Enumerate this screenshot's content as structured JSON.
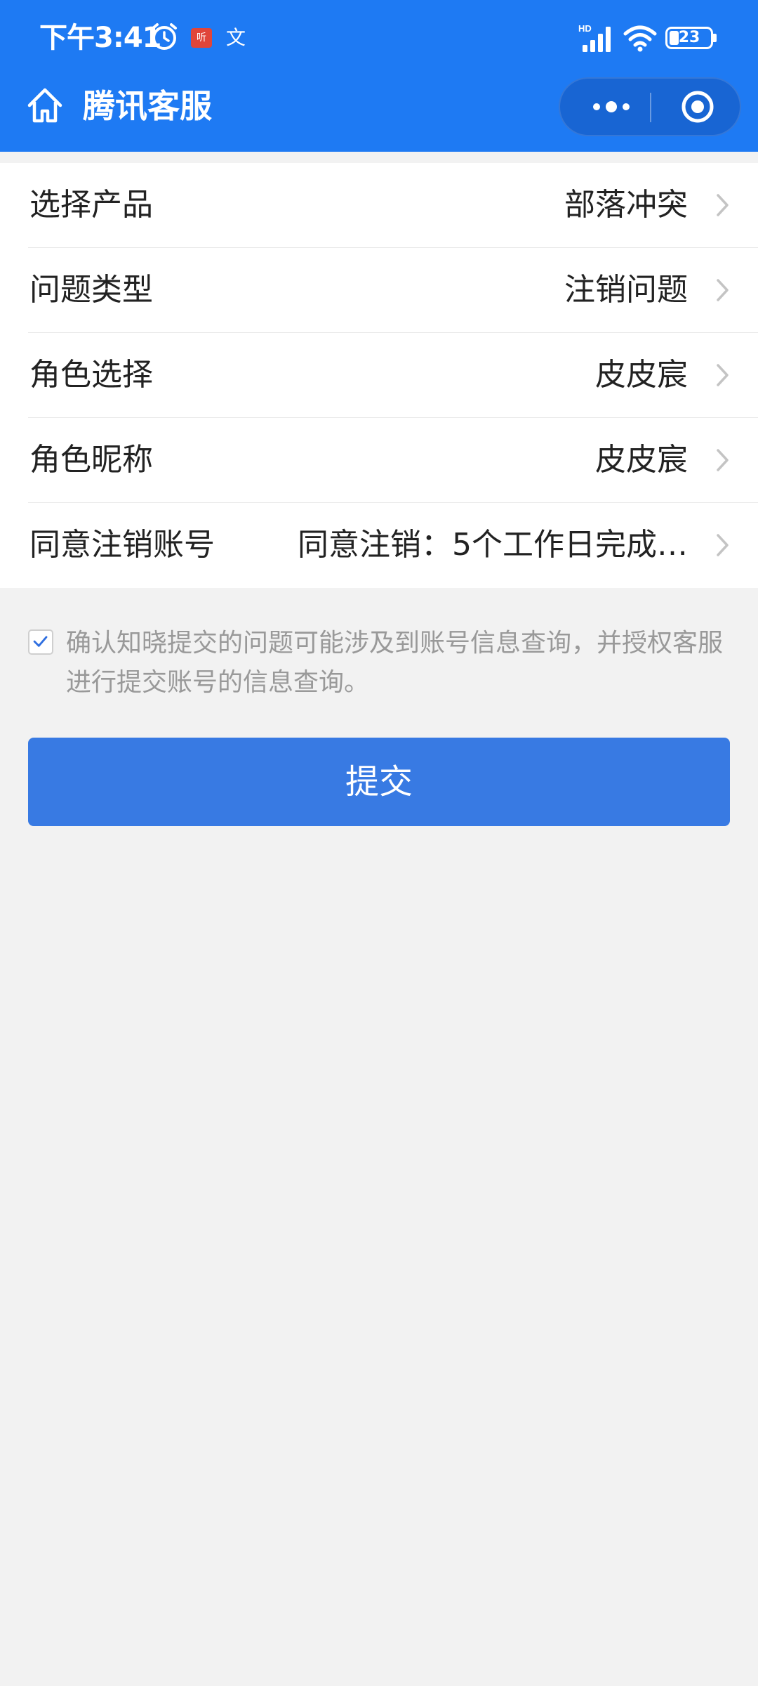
{
  "status_bar": {
    "time": "下午3:41",
    "notification_badge": "听",
    "translate_glyph": "文",
    "signal_label": "HD",
    "battery": "23",
    "battery_level": 0.23
  },
  "header": {
    "title": "腾讯客服",
    "background_color": "#1e7af3"
  },
  "form": {
    "rows": [
      {
        "label": "选择产品",
        "value": "部落冲突"
      },
      {
        "label": "问题类型",
        "value": "注销问题"
      },
      {
        "label": "角色选择",
        "value": "皮皮宸"
      },
      {
        "label": "角色昵称",
        "value": "皮皮宸"
      },
      {
        "label": "同意注销账号",
        "value": "同意注销：5个工作日完成…"
      }
    ]
  },
  "consent": {
    "checked": true,
    "text": "确认知晓提交的问题可能涉及到账号信息查询，并授权客服进行提交账号的信息查询。"
  },
  "submit": {
    "label": "提交",
    "color": "#387ae3"
  },
  "icons": {
    "home": "home-icon",
    "more": "more-dots-icon",
    "close": "close-circle-icon",
    "chevron": "chevron-right-icon",
    "check": "checkmark-icon"
  }
}
